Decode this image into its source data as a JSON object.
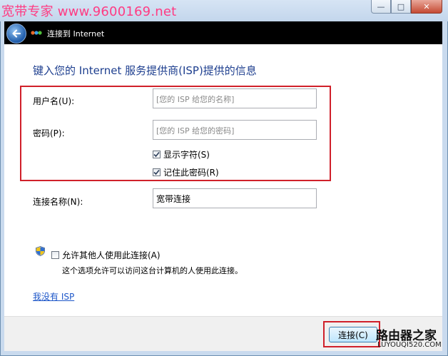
{
  "window": {
    "watermark_title": "宽带专家 www.9600169.net",
    "minimize_glyph": "—",
    "maximize_glyph": "□",
    "close_glyph": "✕"
  },
  "nav": {
    "title": "连接到 Internet",
    "back_icon": "back-arrow-icon",
    "network_icon": "network-connection-icon"
  },
  "form": {
    "heading": "键入您的 Internet 服务提供商(ISP)提供的信息",
    "username_label": "用户名(U):",
    "username_placeholder": "[您的 ISP 给您的名称]",
    "password_label": "密码(P):",
    "password_placeholder": "[您的 ISP 给您的密码]",
    "show_chars_label": "显示字符(S)",
    "show_chars_checked": true,
    "remember_label": "记住此密码(R)",
    "remember_checked": true,
    "conn_name_label": "连接名称(N):",
    "conn_name_value": "宽带连接",
    "allow_others_label": "允许其他人使用此连接(A)",
    "allow_others_checked": false,
    "allow_others_note": "这个选项允许可以访问这台计算机的人使用此连接。",
    "no_isp_link": "我没有 ISP"
  },
  "footer": {
    "connect_label": "连接(C)"
  },
  "logo": {
    "main": "路由器之家",
    "sub": "LUYOUQI520.COM"
  },
  "colors": {
    "highlight_box": "#d0202a",
    "heading": "#1e3f8f",
    "link": "#1e57c9"
  }
}
